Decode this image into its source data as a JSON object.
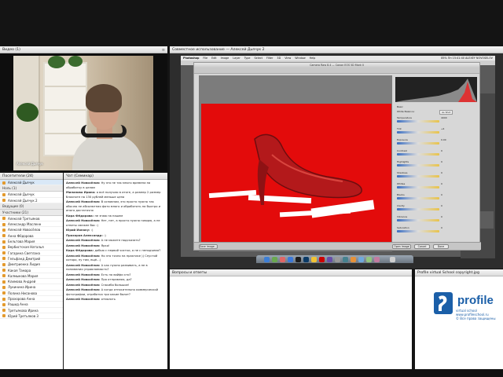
{
  "video": {
    "title": "Видео",
    "count": "(1)",
    "name_tag": "Алексей Дьячук"
  },
  "participants": {
    "title": "Посетители",
    "count": "(24)",
    "me": "Алексей Дьячук",
    "hosts_label": "Ноль (1)",
    "hosts": [
      "Алексей Дьячук",
      "Алексей Дьячук 2"
    ],
    "presenters_label": "Ведущие (0)",
    "guests_label": "Участники (21)",
    "guests": [
      "Алексей Третьяков",
      "Александр Масленн",
      "Алексей Новосёлов",
      "Анна Фёдорова",
      "Бельтова Мария",
      "Вербистская Наталья",
      "Гагарина Светлана",
      "Гельфанд Дмитрий",
      "Дмитриенко Лидия",
      "Какая Тамара",
      "Калмыкова Мария",
      "Климова Андрей",
      "Лукинина Ирина",
      "Полина Нисанова",
      "Прохорова Анна",
      "Рашид Анна",
      "Третьякова Ирина",
      "Юрий Третьяков 3"
    ]
  },
  "chat": {
    "title": "Чат",
    "count": "(Семинар)",
    "messages": [
      {
        "author": "Алексей Новосёлов:",
        "text": "Ну это не так много времени на обработку в целом"
      },
      {
        "author": "Миланова Ирина:",
        "text": "а всё получаю в итоге, а размер 2 размер блокноте на 130 рублей меньше цена"
      },
      {
        "author": "Алексей Новосёлов:",
        "text": "В основном, это просто нужно так обычно не абсолютная фото много и обработать на быстро и иного достаточно"
      },
      {
        "author": "Кира Фёдорова:",
        "text": "не знаю на нашем"
      },
      {
        "author": "Алексей Новосёлов:",
        "text": "Нет, нет, а просто нужно говорю, а не ответы свежее бас :)"
      },
      {
        "author": "Юрий Ионаку:",
        "text": ":)"
      },
      {
        "author": "Прохоров Александр:",
        "text": ":)"
      },
      {
        "author": "Алексей Новосёлов:",
        "text": "А не можете подсказать?"
      },
      {
        "author": "Алексей Новосёлов:",
        "text": "Ярко!"
      },
      {
        "author": "Кира Фёдорова:",
        "text": "добью с первой чистки, а не с неподъема?"
      },
      {
        "author": "Алексей Новосёлов:",
        "text": "Но это точно на практике )) Спустий которо, ну там, ещё...)"
      },
      {
        "author": "Алексей Новосёлов:",
        "text": "А как нужно развивать, а не в понимании управляемость?"
      },
      {
        "author": "Алексей Новосёлов:",
        "text": "Есть на вайфи кто?"
      },
      {
        "author": "Алексей Новосёлов:",
        "text": "Про отправляю, да?"
      },
      {
        "author": "Алексей Новосёлов:",
        "text": "Спасибо большое!"
      },
      {
        "author": "Алексей Новосёлов:",
        "text": "А когда относительно коммерческой фотографии, отработка три какие болит?"
      },
      {
        "author": "Алексей Новосёлов:",
        "text": "отмолоть"
      }
    ]
  },
  "share": {
    "title": "Совместное использование",
    "presenter": "Алексей Дьячук 2",
    "app_menu": [
      "Photoshop",
      "File",
      "Edit",
      "Image",
      "Layer",
      "Type",
      "Select",
      "Filter",
      "3D",
      "View",
      "Window",
      "Help"
    ],
    "menu_right": "85% Пн 15:41:40  ALEXEY NOVOSELOV",
    "acr_title": "Camera Raw 8.4 — Canon EOS 5D Mark II",
    "zoom": "13,5%",
    "file_info": "IMG_1234.CR2",
    "right_panel": {
      "basic_label": "Basic",
      "white_balance_label": "White Balance:",
      "white_balance_value": "As Shot",
      "rows": [
        {
          "label": "Temperature",
          "value": "4900"
        },
        {
          "label": "Tint",
          "value": "+4"
        },
        {
          "label": "Exposure",
          "value": "0.00"
        },
        {
          "label": "Contrast",
          "value": "0"
        },
        {
          "label": "Highlights",
          "value": "0"
        },
        {
          "label": "Shadows",
          "value": "0"
        },
        {
          "label": "Whites",
          "value": "0"
        },
        {
          "label": "Blacks",
          "value": "0"
        },
        {
          "label": "Clarity",
          "value": "0"
        },
        {
          "label": "Vibrance",
          "value": "0"
        },
        {
          "label": "Saturation",
          "value": "0"
        }
      ],
      "auto": "Auto",
      "default": "Default"
    },
    "buttons": {
      "save": "Save Image...",
      "open": "Open Image",
      "cancel": "Cancel",
      "done": "Done"
    },
    "colors": {
      "backdrop": "#e30b0b",
      "shoe": "#b3191b"
    }
  },
  "qa": {
    "title": "Вопросы и ответы"
  },
  "logo": {
    "title": "Profile virtual School copyright.jpg",
    "brand": "profile",
    "sub1": "virtual school",
    "site": "www.profileschool.ru",
    "copy": "© Все права защищены"
  }
}
